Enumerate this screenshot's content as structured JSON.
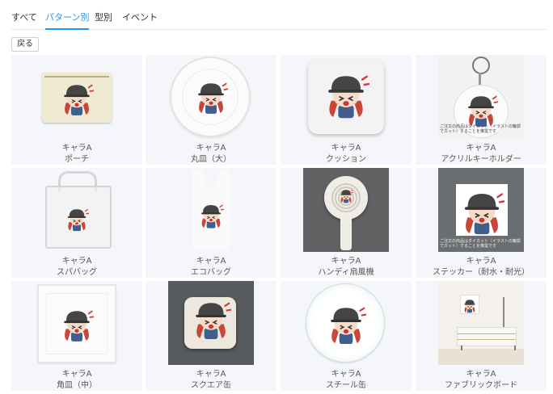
{
  "tabs": [
    {
      "label": "すべて",
      "active": false
    },
    {
      "label": "パターン別",
      "active": true
    },
    {
      "label": "型別",
      "active": false
    },
    {
      "label": "イベント",
      "active": false
    }
  ],
  "back_label": "戻る",
  "colors": {
    "accent": "#2196f3",
    "card_bg": "#f4f6f9"
  },
  "products": [
    {
      "character": "キャラA",
      "item": "ポーチ",
      "icon": "pouch"
    },
    {
      "character": "キャラA",
      "item": "丸皿（大）",
      "icon": "round-plate"
    },
    {
      "character": "キャラA",
      "item": "クッション",
      "icon": "cushion"
    },
    {
      "character": "キャラA",
      "item": "アクリルキーホルダー",
      "icon": "acrylic-keychain"
    },
    {
      "character": "キャラA",
      "item": "スパバッグ",
      "icon": "spa-bag"
    },
    {
      "character": "キャラA",
      "item": "エコバッグ",
      "icon": "eco-bag"
    },
    {
      "character": "キャラA",
      "item": "ハンディ扇風機",
      "icon": "handy-fan"
    },
    {
      "character": "キャラA",
      "item": "ステッカー（耐水・耐光）",
      "icon": "sticker"
    },
    {
      "character": "キャラA",
      "item": "角皿（中）",
      "icon": "square-plate"
    },
    {
      "character": "キャラA",
      "item": "スクエア缶",
      "icon": "square-can"
    },
    {
      "character": "キャラA",
      "item": "スチール缶",
      "icon": "steel-can"
    },
    {
      "character": "キャラA",
      "item": "ファブリックボード",
      "icon": "fabric-board"
    }
  ],
  "notes": {
    "keychain": "ご注文の商品はダイカット（イラストの輪郭でカット）することを推奨です",
    "sticker": "ご注文の商品はダイカット（イラストの輪郭でカット）することを推奨です"
  }
}
